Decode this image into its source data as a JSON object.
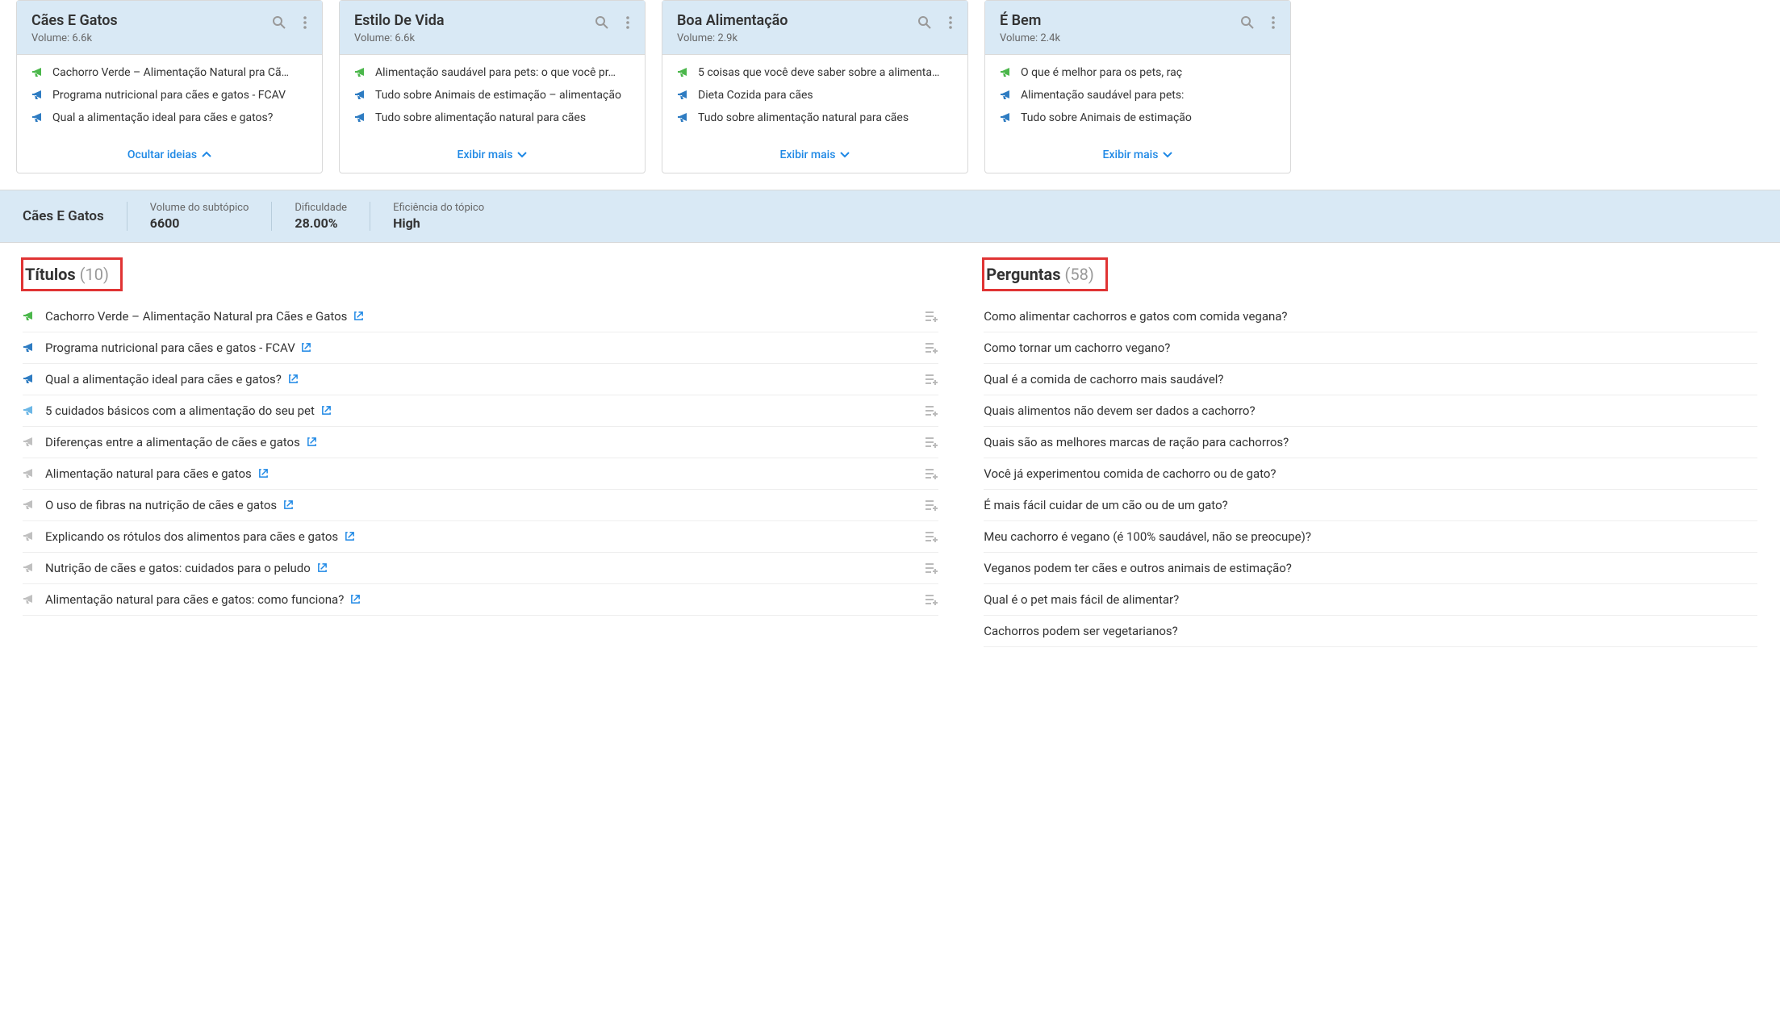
{
  "labels": {
    "volume_prefix": "Volume:",
    "hide_ideas": "Ocultar ideias",
    "show_more": "Exibir mais"
  },
  "cards": [
    {
      "title": "Cães E Gatos",
      "volume": "6.6k",
      "items": [
        {
          "iconColor": "green",
          "text": "Cachorro Verde – Alimentação Natural pra Cã…"
        },
        {
          "iconColor": "blue",
          "text": "Programa nutricional para cães e gatos - FCAV"
        },
        {
          "iconColor": "blue",
          "text": "Qual a alimentação ideal para cães e gatos?"
        }
      ],
      "footer": "hide"
    },
    {
      "title": "Estilo De Vida",
      "volume": "6.6k",
      "items": [
        {
          "iconColor": "green",
          "text": "Alimentação saudável para pets: o que você pr…"
        },
        {
          "iconColor": "blue",
          "text": "Tudo sobre Animais de estimação – alimentação"
        },
        {
          "iconColor": "blue",
          "text": "Tudo sobre alimentação natural para cães"
        }
      ],
      "footer": "more"
    },
    {
      "title": "Boa Alimentação",
      "volume": "2.9k",
      "items": [
        {
          "iconColor": "green",
          "text": "5 coisas que você deve saber sobre a alimenta…"
        },
        {
          "iconColor": "blue",
          "text": "Dieta Cozida para cães"
        },
        {
          "iconColor": "blue",
          "text": "Tudo sobre alimentação natural para cães"
        }
      ],
      "footer": "more"
    },
    {
      "title": "É Bem",
      "volume": "2.4k",
      "items": [
        {
          "iconColor": "green",
          "text": "O que é melhor para os pets, raç"
        },
        {
          "iconColor": "blue",
          "text": "Alimentação saudável para pets:"
        },
        {
          "iconColor": "blue",
          "text": "Tudo sobre Animais de estimação"
        }
      ],
      "footer": "more"
    }
  ],
  "detail": {
    "title": "Cães E Gatos",
    "metrics": [
      {
        "label": "Volume do subtópico",
        "value": "6600"
      },
      {
        "label": "Dificuldade",
        "value": "28.00%"
      },
      {
        "label": "Eficiência do tópico",
        "value": "High"
      }
    ],
    "titles_label": "Títulos",
    "titles_count": "(10)",
    "titles": [
      {
        "iconColor": "green",
        "text": "Cachorro Verde – Alimentação Natural pra Cães e Gatos"
      },
      {
        "iconColor": "blue",
        "text": "Programa nutricional para cães e gatos - FCAV"
      },
      {
        "iconColor": "blue",
        "text": "Qual a alimentação ideal para cães e gatos?"
      },
      {
        "iconColor": "lightblue",
        "text": "5 cuidados básicos com a alimentação do seu pet"
      },
      {
        "iconColor": "gray",
        "text": "Diferenças entre a alimentação de cães e gatos"
      },
      {
        "iconColor": "gray",
        "text": "Alimentação natural para cães e gatos"
      },
      {
        "iconColor": "gray",
        "text": "O uso de fibras na nutrição de cães e gatos"
      },
      {
        "iconColor": "gray",
        "text": "Explicando os rótulos dos alimentos para cães e gatos"
      },
      {
        "iconColor": "gray",
        "text": "Nutrição de cães e gatos: cuidados para o peludo"
      },
      {
        "iconColor": "gray",
        "text": "Alimentação natural para cães e gatos: como funciona?"
      }
    ],
    "questions_label": "Perguntas",
    "questions_count": "(58)",
    "questions": [
      "Como alimentar cachorros e gatos com comida vegana?",
      "Como tornar um cachorro vegano?",
      "Qual é a comida de cachorro mais saudável?",
      "Quais alimentos não devem ser dados a cachorro?",
      "Quais são as melhores marcas de ração para cachorros?",
      "Você já experimentou comida de cachorro ou de gato?",
      "É mais fácil cuidar de um cão ou de um gato?",
      "Meu cachorro é vegano (é 100% saudável, não se preocupe)?",
      "Veganos podem ter cães e outros animais de estimação?",
      "Qual é o pet mais fácil de alimentar?",
      "Cachorros podem ser vegetarianos?"
    ]
  }
}
